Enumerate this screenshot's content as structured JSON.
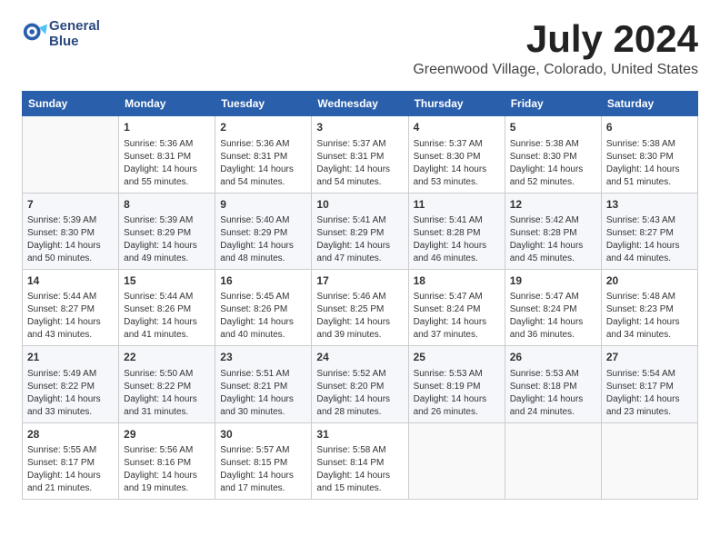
{
  "header": {
    "logo_line1": "General",
    "logo_line2": "Blue",
    "month": "July 2024",
    "location": "Greenwood Village, Colorado, United States"
  },
  "days_of_week": [
    "Sunday",
    "Monday",
    "Tuesday",
    "Wednesday",
    "Thursday",
    "Friday",
    "Saturday"
  ],
  "weeks": [
    [
      {
        "day": "",
        "info": ""
      },
      {
        "day": "1",
        "info": "Sunrise: 5:36 AM\nSunset: 8:31 PM\nDaylight: 14 hours\nand 55 minutes."
      },
      {
        "day": "2",
        "info": "Sunrise: 5:36 AM\nSunset: 8:31 PM\nDaylight: 14 hours\nand 54 minutes."
      },
      {
        "day": "3",
        "info": "Sunrise: 5:37 AM\nSunset: 8:31 PM\nDaylight: 14 hours\nand 54 minutes."
      },
      {
        "day": "4",
        "info": "Sunrise: 5:37 AM\nSunset: 8:30 PM\nDaylight: 14 hours\nand 53 minutes."
      },
      {
        "day": "5",
        "info": "Sunrise: 5:38 AM\nSunset: 8:30 PM\nDaylight: 14 hours\nand 52 minutes."
      },
      {
        "day": "6",
        "info": "Sunrise: 5:38 AM\nSunset: 8:30 PM\nDaylight: 14 hours\nand 51 minutes."
      }
    ],
    [
      {
        "day": "7",
        "info": "Sunrise: 5:39 AM\nSunset: 8:30 PM\nDaylight: 14 hours\nand 50 minutes."
      },
      {
        "day": "8",
        "info": "Sunrise: 5:39 AM\nSunset: 8:29 PM\nDaylight: 14 hours\nand 49 minutes."
      },
      {
        "day": "9",
        "info": "Sunrise: 5:40 AM\nSunset: 8:29 PM\nDaylight: 14 hours\nand 48 minutes."
      },
      {
        "day": "10",
        "info": "Sunrise: 5:41 AM\nSunset: 8:29 PM\nDaylight: 14 hours\nand 47 minutes."
      },
      {
        "day": "11",
        "info": "Sunrise: 5:41 AM\nSunset: 8:28 PM\nDaylight: 14 hours\nand 46 minutes."
      },
      {
        "day": "12",
        "info": "Sunrise: 5:42 AM\nSunset: 8:28 PM\nDaylight: 14 hours\nand 45 minutes."
      },
      {
        "day": "13",
        "info": "Sunrise: 5:43 AM\nSunset: 8:27 PM\nDaylight: 14 hours\nand 44 minutes."
      }
    ],
    [
      {
        "day": "14",
        "info": "Sunrise: 5:44 AM\nSunset: 8:27 PM\nDaylight: 14 hours\nand 43 minutes."
      },
      {
        "day": "15",
        "info": "Sunrise: 5:44 AM\nSunset: 8:26 PM\nDaylight: 14 hours\nand 41 minutes."
      },
      {
        "day": "16",
        "info": "Sunrise: 5:45 AM\nSunset: 8:26 PM\nDaylight: 14 hours\nand 40 minutes."
      },
      {
        "day": "17",
        "info": "Sunrise: 5:46 AM\nSunset: 8:25 PM\nDaylight: 14 hours\nand 39 minutes."
      },
      {
        "day": "18",
        "info": "Sunrise: 5:47 AM\nSunset: 8:24 PM\nDaylight: 14 hours\nand 37 minutes."
      },
      {
        "day": "19",
        "info": "Sunrise: 5:47 AM\nSunset: 8:24 PM\nDaylight: 14 hours\nand 36 minutes."
      },
      {
        "day": "20",
        "info": "Sunrise: 5:48 AM\nSunset: 8:23 PM\nDaylight: 14 hours\nand 34 minutes."
      }
    ],
    [
      {
        "day": "21",
        "info": "Sunrise: 5:49 AM\nSunset: 8:22 PM\nDaylight: 14 hours\nand 33 minutes."
      },
      {
        "day": "22",
        "info": "Sunrise: 5:50 AM\nSunset: 8:22 PM\nDaylight: 14 hours\nand 31 minutes."
      },
      {
        "day": "23",
        "info": "Sunrise: 5:51 AM\nSunset: 8:21 PM\nDaylight: 14 hours\nand 30 minutes."
      },
      {
        "day": "24",
        "info": "Sunrise: 5:52 AM\nSunset: 8:20 PM\nDaylight: 14 hours\nand 28 minutes."
      },
      {
        "day": "25",
        "info": "Sunrise: 5:53 AM\nSunset: 8:19 PM\nDaylight: 14 hours\nand 26 minutes."
      },
      {
        "day": "26",
        "info": "Sunrise: 5:53 AM\nSunset: 8:18 PM\nDaylight: 14 hours\nand 24 minutes."
      },
      {
        "day": "27",
        "info": "Sunrise: 5:54 AM\nSunset: 8:17 PM\nDaylight: 14 hours\nand 23 minutes."
      }
    ],
    [
      {
        "day": "28",
        "info": "Sunrise: 5:55 AM\nSunset: 8:17 PM\nDaylight: 14 hours\nand 21 minutes."
      },
      {
        "day": "29",
        "info": "Sunrise: 5:56 AM\nSunset: 8:16 PM\nDaylight: 14 hours\nand 19 minutes."
      },
      {
        "day": "30",
        "info": "Sunrise: 5:57 AM\nSunset: 8:15 PM\nDaylight: 14 hours\nand 17 minutes."
      },
      {
        "day": "31",
        "info": "Sunrise: 5:58 AM\nSunset: 8:14 PM\nDaylight: 14 hours\nand 15 minutes."
      },
      {
        "day": "",
        "info": ""
      },
      {
        "day": "",
        "info": ""
      },
      {
        "day": "",
        "info": ""
      }
    ]
  ]
}
